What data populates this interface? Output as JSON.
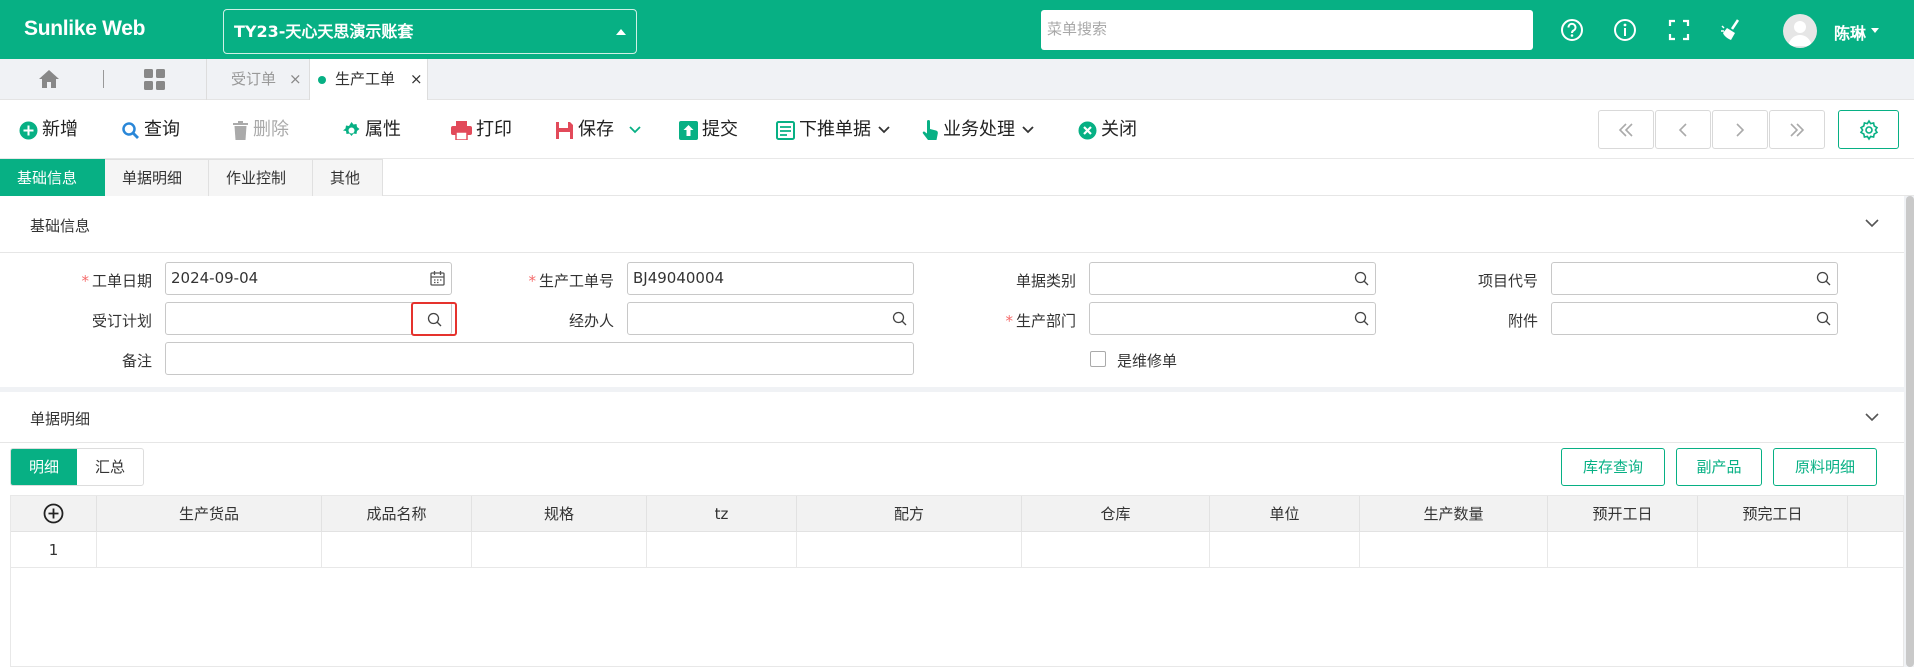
{
  "header": {
    "brand": "Sunlike Web",
    "account": "TY23-天心天思演示账套",
    "search_placeholder": "菜单搜索",
    "username": "陈琳",
    "icons": [
      "help-icon",
      "info-icon",
      "fullscreen-icon",
      "clean-icon"
    ]
  },
  "tabs": {
    "items": [
      {
        "label": "受订单",
        "active": false
      },
      {
        "label": "生产工单",
        "active": true
      }
    ],
    "close_glyph": "×"
  },
  "toolbar": {
    "new": "新增",
    "query": "查询",
    "delete": "删除",
    "properties": "属性",
    "print": "打印",
    "save": "保存",
    "submit": "提交",
    "push_down": "下推单据",
    "business": "业务处理",
    "close": "关闭"
  },
  "section_tabs": [
    "基础信息",
    "单据明细",
    "作业控制",
    "其他"
  ],
  "basic": {
    "title": "基础信息",
    "fields": {
      "work_date_label": "工单日期",
      "work_date_value": "2024-09-04",
      "order_no_label": "生产工单号",
      "order_no_value": "BJ49040004",
      "doc_type_label": "单据类别",
      "project_label": "项目代号",
      "order_plan_label": "受订计划",
      "handler_label": "经办人",
      "dept_label": "生产部门",
      "attachment_label": "附件",
      "remark_label": "备注",
      "repair_label": "是维修单"
    },
    "required_mark": "*"
  },
  "detail": {
    "title": "单据明细",
    "subtabs": [
      "明细",
      "汇总"
    ],
    "buttons": [
      "库存查询",
      "副产品",
      "原料明细"
    ],
    "columns": [
      "生产货品",
      "成品名称",
      "规格",
      "tz",
      "配方",
      "仓库",
      "单位",
      "生产数量",
      "预开工日",
      "预完工日"
    ],
    "rows": [
      {
        "no": "1"
      }
    ]
  },
  "colors": {
    "accent": "#07b084",
    "required": "#f56c6c",
    "highlight": "#e5322d"
  }
}
